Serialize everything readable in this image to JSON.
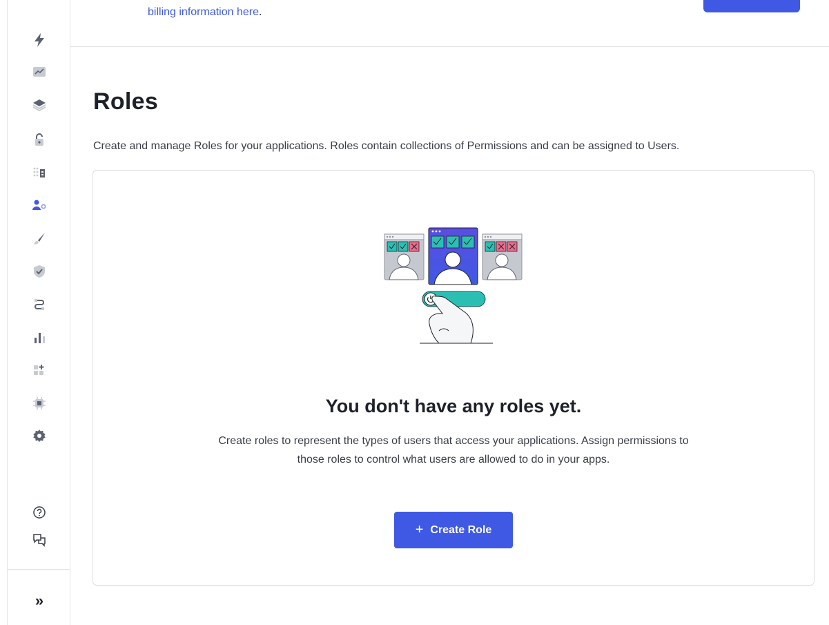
{
  "banner": {
    "link_text": "billing information here",
    "suffix": "."
  },
  "page": {
    "title": "Roles",
    "description": "Create and manage Roles for your applications. Roles contain collections of Permissions and can be assigned to Users."
  },
  "empty_state": {
    "title": "You don't have any roles yet.",
    "description": "Create roles to represent the types of users that access your applications. Assign permissions to those roles to control what users are allowed to do in your apps.",
    "button_icon": "+",
    "button_label": "Create Role"
  },
  "sidebar": {
    "items": [
      {
        "icon": "lightning-icon"
      },
      {
        "icon": "activity-chart-icon"
      },
      {
        "icon": "layers-icon"
      },
      {
        "icon": "lock-icon"
      },
      {
        "icon": "organizations-icon"
      },
      {
        "icon": "user-management-icon",
        "active": true
      },
      {
        "icon": "branding-brush-icon"
      },
      {
        "icon": "shield-check-icon"
      },
      {
        "icon": "actions-flow-icon"
      },
      {
        "icon": "monitoring-bar-chart-icon"
      },
      {
        "icon": "marketplace-add-icon"
      },
      {
        "icon": "extensions-chip-icon"
      },
      {
        "icon": "settings-gear-icon"
      }
    ],
    "help_icon": "help-circle-icon",
    "feedback_icon": "feedback-chat-icon",
    "expand_icon": "expand-chevrons-icon",
    "expand_glyph": "»"
  },
  "colors": {
    "accent": "#3f59e4",
    "text": "#1e212a",
    "muted": "#3a3e48",
    "icon": "#5c6070",
    "icon_light": "#c7cad1"
  }
}
